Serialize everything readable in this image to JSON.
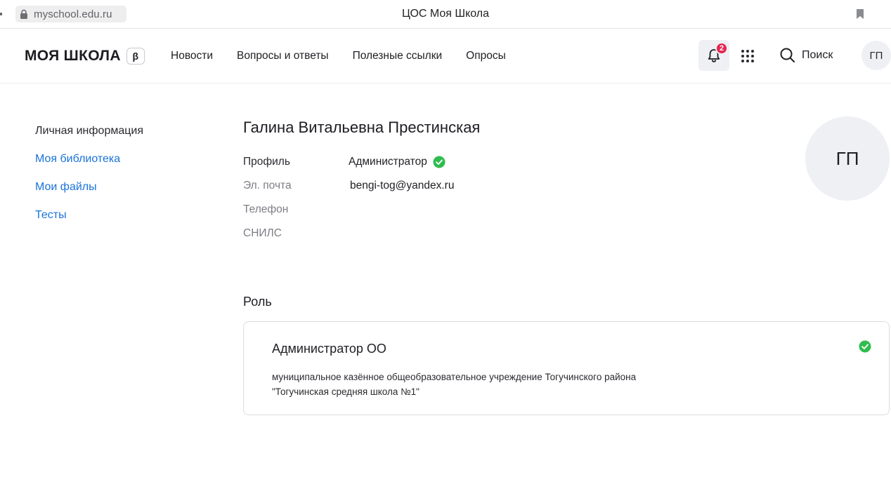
{
  "browser": {
    "url": "myschool.edu.ru",
    "title": "ЦОС Моя Школа"
  },
  "header": {
    "logo": "МОЯ ШКОЛА",
    "beta": "β",
    "nav": [
      {
        "label": "Новости"
      },
      {
        "label": "Вопросы и ответы"
      },
      {
        "label": "Полезные ссылки"
      },
      {
        "label": "Опросы"
      }
    ],
    "notifications_count": "2",
    "search_label": "Поиск",
    "avatar_initials": "ГП"
  },
  "sidebar": {
    "items": [
      {
        "label": "Личная информация"
      },
      {
        "label": "Моя библиотека"
      },
      {
        "label": "Мои файлы"
      },
      {
        "label": "Тесты"
      }
    ]
  },
  "profile": {
    "full_name": "Галина Витальевна Престинская",
    "avatar_initials": "ГП",
    "fields": [
      {
        "label": "Профиль",
        "value": "Администратор"
      },
      {
        "label": "Эл. почта",
        "value": "bengi-tog@yandex.ru"
      },
      {
        "label": "Телефон",
        "value": ""
      },
      {
        "label": "СНИЛС",
        "value": ""
      }
    ]
  },
  "role": {
    "section_title": "Роль",
    "name": "Администратор ОО",
    "org_line1": "муниципальное казённое общеобразовательное учреждение Тогучинского района",
    "org_line2": "\"Тогучинская средняя школа №1\""
  },
  "colors": {
    "link": "#1a73d9",
    "badge": "#e5264e",
    "check": "#2ebd4e",
    "avatar_bg": "#eef0f4"
  }
}
